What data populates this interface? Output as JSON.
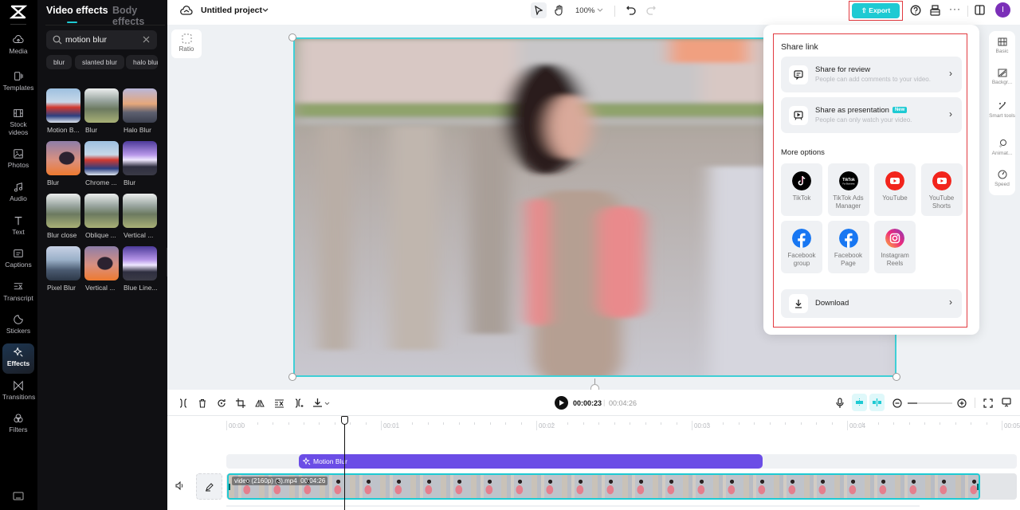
{
  "rail": {
    "items": [
      {
        "label": "Media",
        "icon": "cloud-upload-icon"
      },
      {
        "label": "Templates",
        "icon": "templates-icon"
      },
      {
        "label": "Stock videos",
        "icon": "film-icon"
      },
      {
        "label": "Photos",
        "icon": "image-icon"
      },
      {
        "label": "Audio",
        "icon": "music-icon"
      },
      {
        "label": "Text",
        "icon": "text-icon"
      },
      {
        "label": "Captions",
        "icon": "captions-icon"
      },
      {
        "label": "Transcript",
        "icon": "transcript-icon"
      },
      {
        "label": "Stickers",
        "icon": "sticker-icon"
      },
      {
        "label": "Effects",
        "icon": "sparkle-icon",
        "active": true
      },
      {
        "label": "Transitions",
        "icon": "transition-icon"
      },
      {
        "label": "Filters",
        "icon": "filters-icon"
      }
    ]
  },
  "panel": {
    "tabs": [
      {
        "label": "Video effects",
        "active": true
      },
      {
        "label": "Body effects",
        "active": false
      }
    ],
    "search": {
      "value": "motion blur",
      "placeholder": "Search"
    },
    "chips": [
      "blur",
      "slanted blur",
      "halo blur"
    ],
    "effects": [
      {
        "label": "Motion B...",
        "palette": "person-red"
      },
      {
        "label": "Blur",
        "palette": "forest"
      },
      {
        "label": "Halo Blur",
        "palette": "city-sunset"
      },
      {
        "label": "Blur",
        "palette": "silhouette"
      },
      {
        "label": "Chrome ...",
        "palette": "person-red"
      },
      {
        "label": "Blur",
        "palette": "purple-light"
      },
      {
        "label": "Blur close",
        "palette": "forest"
      },
      {
        "label": "Oblique ...",
        "palette": "forest"
      },
      {
        "label": "Vertical ...",
        "palette": "forest"
      },
      {
        "label": "Pixel Blur",
        "palette": "city-day"
      },
      {
        "label": "Vertical ...",
        "palette": "silhouette"
      },
      {
        "label": "Blue Line...",
        "palette": "purple-light"
      }
    ]
  },
  "header": {
    "project_title": "Untitled project",
    "zoom": "100%",
    "export_label": "Export",
    "avatar_initial": "I",
    "colors": {
      "export": "#1ecad3",
      "avatar": "#7b2fb8"
    }
  },
  "canvas": {
    "ratio_label": "Ratio"
  },
  "share": {
    "share_link_title": "Share link",
    "review": {
      "title": "Share for review",
      "desc": "People can add comments to your video."
    },
    "presentation": {
      "title": "Share as presentation",
      "badge": "New",
      "desc": "People can only watch your video."
    },
    "more_options_title": "More options",
    "platforms": [
      {
        "label": "TikTok",
        "icon": "tiktok-icon"
      },
      {
        "label": "TikTok Ads Manager",
        "icon": "tiktok-business-icon"
      },
      {
        "label": "YouTube",
        "icon": "youtube-icon"
      },
      {
        "label": "YouTube Shorts",
        "icon": "youtube-shorts-icon"
      },
      {
        "label": "Facebook group",
        "icon": "facebook-icon"
      },
      {
        "label": "Facebook Page",
        "icon": "facebook-icon"
      },
      {
        "label": "Instagram Reels",
        "icon": "instagram-icon"
      }
    ],
    "download_label": "Download"
  },
  "props": {
    "items": [
      "Basic",
      "Backgr...",
      "Smart tools",
      "Animat...",
      "Speed"
    ]
  },
  "timeline": {
    "current_time": "00:00:23",
    "total_time": "00:04:26",
    "ticks": [
      "00:00",
      "00:01",
      "00:02",
      "00:03",
      "00:04",
      "00:05"
    ],
    "effect_clip_label": "Motion Blur",
    "video_clip_name": "video (2160p) (3).mp4",
    "video_clip_duration": "00:04:26"
  }
}
